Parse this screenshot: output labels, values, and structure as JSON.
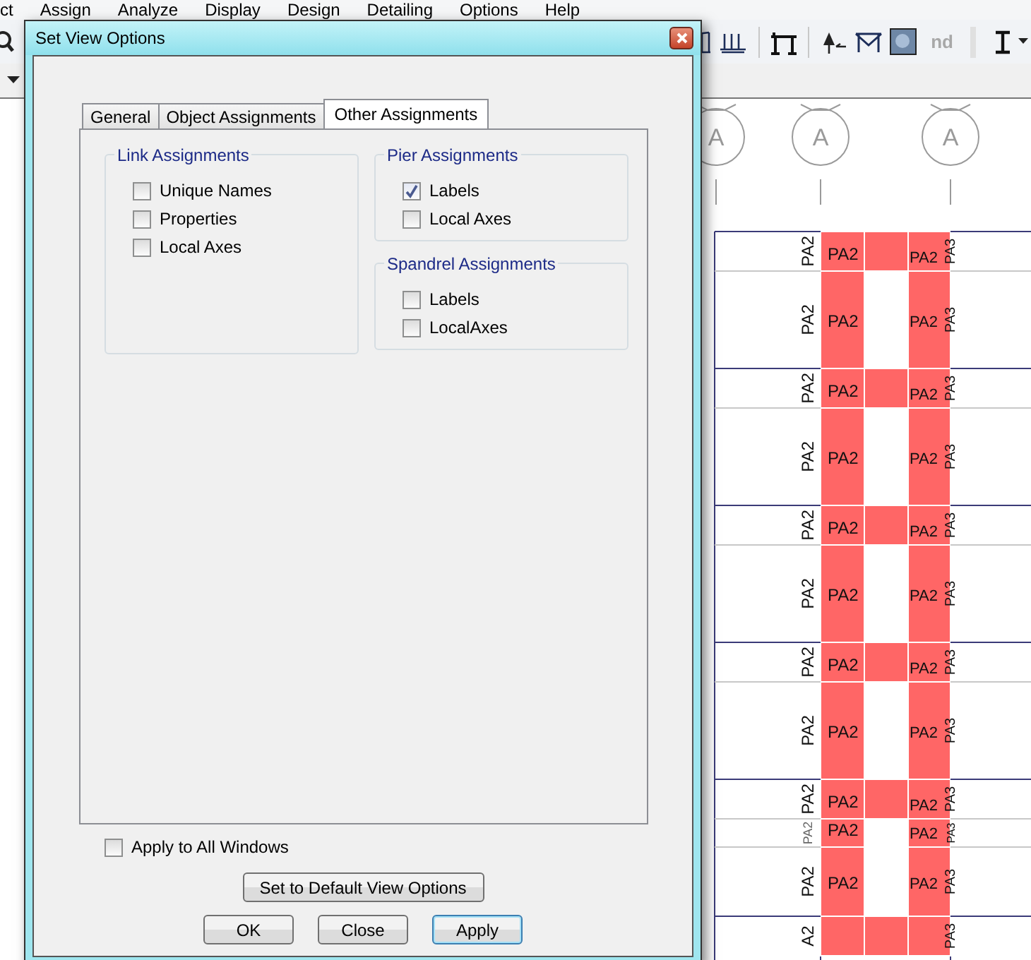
{
  "menu": [
    "ct",
    "Assign",
    "Analyze",
    "Display",
    "Design",
    "Detailing",
    "Options",
    "Help"
  ],
  "toolbar": {
    "greyed_text": "nd"
  },
  "drawing": {
    "grid_bubbles": [
      "A",
      "A",
      "A"
    ],
    "rows": [
      {
        "kind": "short",
        "side_label": "PA2",
        "label": "PA2",
        "right_label": "PA2",
        "right_tag": "PA3"
      },
      {
        "kind": "tall",
        "side_label": "PA2",
        "label": "PA2",
        "right_label": "PA2",
        "right_tag": "PA3"
      },
      {
        "kind": "short",
        "side_label": "PA2",
        "label": "PA2",
        "right_label": "PA2",
        "right_tag": "PA3"
      },
      {
        "kind": "tall",
        "side_label": "PA2",
        "label": "PA2",
        "right_label": "PA2",
        "right_tag": "PA3"
      },
      {
        "kind": "short",
        "side_label": "PA2",
        "label": "PA2",
        "right_label": "PA2",
        "right_tag": "PA3"
      },
      {
        "kind": "tall",
        "side_label": "PA2",
        "label": "PA2",
        "right_label": "PA2",
        "right_tag": "PA3"
      },
      {
        "kind": "short",
        "side_label": "PA2",
        "label": "PA2",
        "right_label": "PA2",
        "right_tag": "PA3"
      },
      {
        "kind": "tall",
        "side_label": "PA2",
        "label": "PA2",
        "right_label": "PA2",
        "right_tag": "PA3"
      },
      {
        "kind": "short",
        "side_label": "PA2",
        "label": "PA2",
        "right_label": "PA2",
        "right_tag": "PA3"
      },
      {
        "kind": "tiny",
        "side_label": "PA2",
        "label": "PA2",
        "right_label": "PA2",
        "right_tag": "PA3"
      },
      {
        "kind": "medium",
        "side_label": "PA2",
        "label": "PA2",
        "right_label": "PA2",
        "right_tag": "PA3"
      },
      {
        "kind": "short",
        "side_label": "A2",
        "right_tag": "PA3"
      }
    ]
  },
  "dialog": {
    "title": "Set View Options",
    "tabs": [
      {
        "label": "General",
        "selected": false
      },
      {
        "label": "Object Assignments",
        "selected": false
      },
      {
        "label": "Other Assignments",
        "selected": true
      }
    ],
    "groups": [
      {
        "title": "Link Assignments",
        "items": [
          {
            "label": "Unique Names",
            "checked": false
          },
          {
            "label": "Properties",
            "checked": false
          },
          {
            "label": "Local Axes",
            "checked": false
          }
        ]
      },
      {
        "title": "Pier Assignments",
        "items": [
          {
            "label": "Labels",
            "checked": true
          },
          {
            "label": "Local Axes",
            "checked": false
          }
        ]
      },
      {
        "title": "Spandrel Assignments",
        "items": [
          {
            "label": "Labels",
            "checked": false
          },
          {
            "label": "LocalAxes",
            "checked": false
          }
        ]
      }
    ],
    "apply_to_all": {
      "label": "Apply to All Windows",
      "checked": false
    },
    "default_button": "Set to Default View Options",
    "buttons": [
      {
        "label": "OK",
        "focused": false
      },
      {
        "label": "Close",
        "focused": false
      },
      {
        "label": "Apply",
        "focused": true
      }
    ]
  }
}
